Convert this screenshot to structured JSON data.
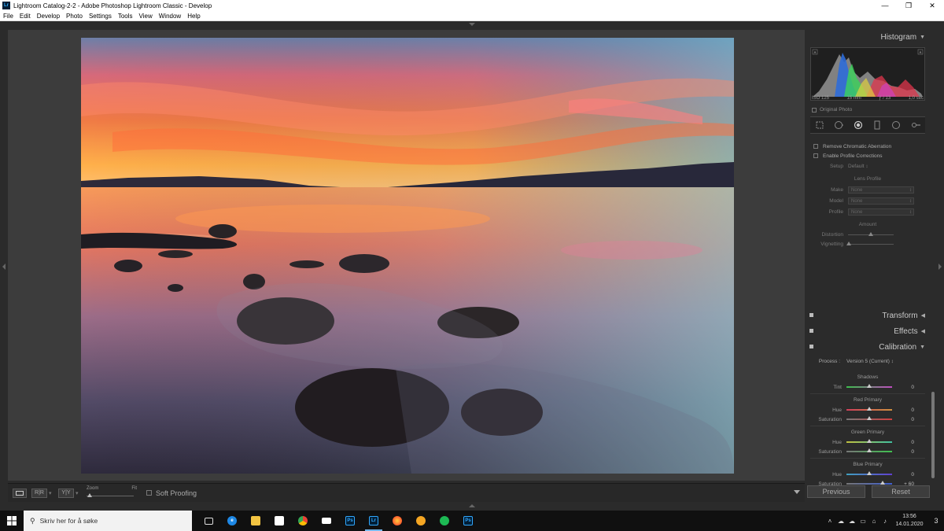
{
  "window": {
    "title": "Lightroom Catalog-2-2 - Adobe Photoshop Lightroom Classic - Develop",
    "app_icon": "Lr",
    "minimize": "—",
    "maximize": "❐",
    "close": "✕"
  },
  "menu": [
    "File",
    "Edit",
    "Develop",
    "Photo",
    "Settings",
    "Tools",
    "View",
    "Window",
    "Help"
  ],
  "toolbar": {
    "zoom_label": "Zoom",
    "zoom_fit": "Fit",
    "soft_proofing": "Soft Proofing",
    "compare_a": "R|R",
    "compare_b": "Y|Y"
  },
  "histogram": {
    "title": "Histogram",
    "iso": "ISO 125",
    "focal": "15 mm",
    "aperture": "ƒ / 13",
    "shutter": "1,0 sec",
    "original_photo": "Original Photo"
  },
  "lens": {
    "remove_ca": "Remove Chromatic Aberration",
    "enable_profile": "Enable Profile Corrections",
    "setup_label": "Setup",
    "setup_value": "Default ↕",
    "lens_profile": "Lens Profile",
    "make_label": "Make",
    "model_label": "Model",
    "profile_label": "Profile",
    "none": "None",
    "amount": "Amount",
    "distortion": "Distortion",
    "vignetting": "Vignetting"
  },
  "panels": {
    "transform": "Transform",
    "effects": "Effects",
    "calibration": "Calibration"
  },
  "calibration": {
    "process_label": "Process :",
    "process_value": "Version 5 (Current) ↕",
    "shadows": "Shadows",
    "tint_label": "Tint",
    "tint_value": "0",
    "red_primary": "Red Primary",
    "green_primary": "Green Primary",
    "blue_primary": "Blue Primary",
    "hue_label": "Hue",
    "saturation_label": "Saturation",
    "red_hue": "0",
    "red_sat": "0",
    "green_hue": "0",
    "green_sat": "0",
    "blue_hue": "0",
    "blue_sat": "+ 60",
    "slider_levels": {
      "tint": 0.5,
      "red_hue": 0.5,
      "red_sat": 0.5,
      "green_hue": 0.5,
      "green_sat": 0.5,
      "blue_hue": 0.5,
      "blue_sat": 0.8
    }
  },
  "buttons": {
    "previous": "Previous",
    "reset": "Reset"
  },
  "taskbar": {
    "search_placeholder": "Skriv her for å søke",
    "time": "13:56",
    "date": "14.01.2020",
    "notifications": "3"
  },
  "colors": {
    "accent_blue": "#76b9ed",
    "panel_bg": "#2b2b2b",
    "photoshop": "#31a8ff",
    "spotify": "#1db954"
  }
}
